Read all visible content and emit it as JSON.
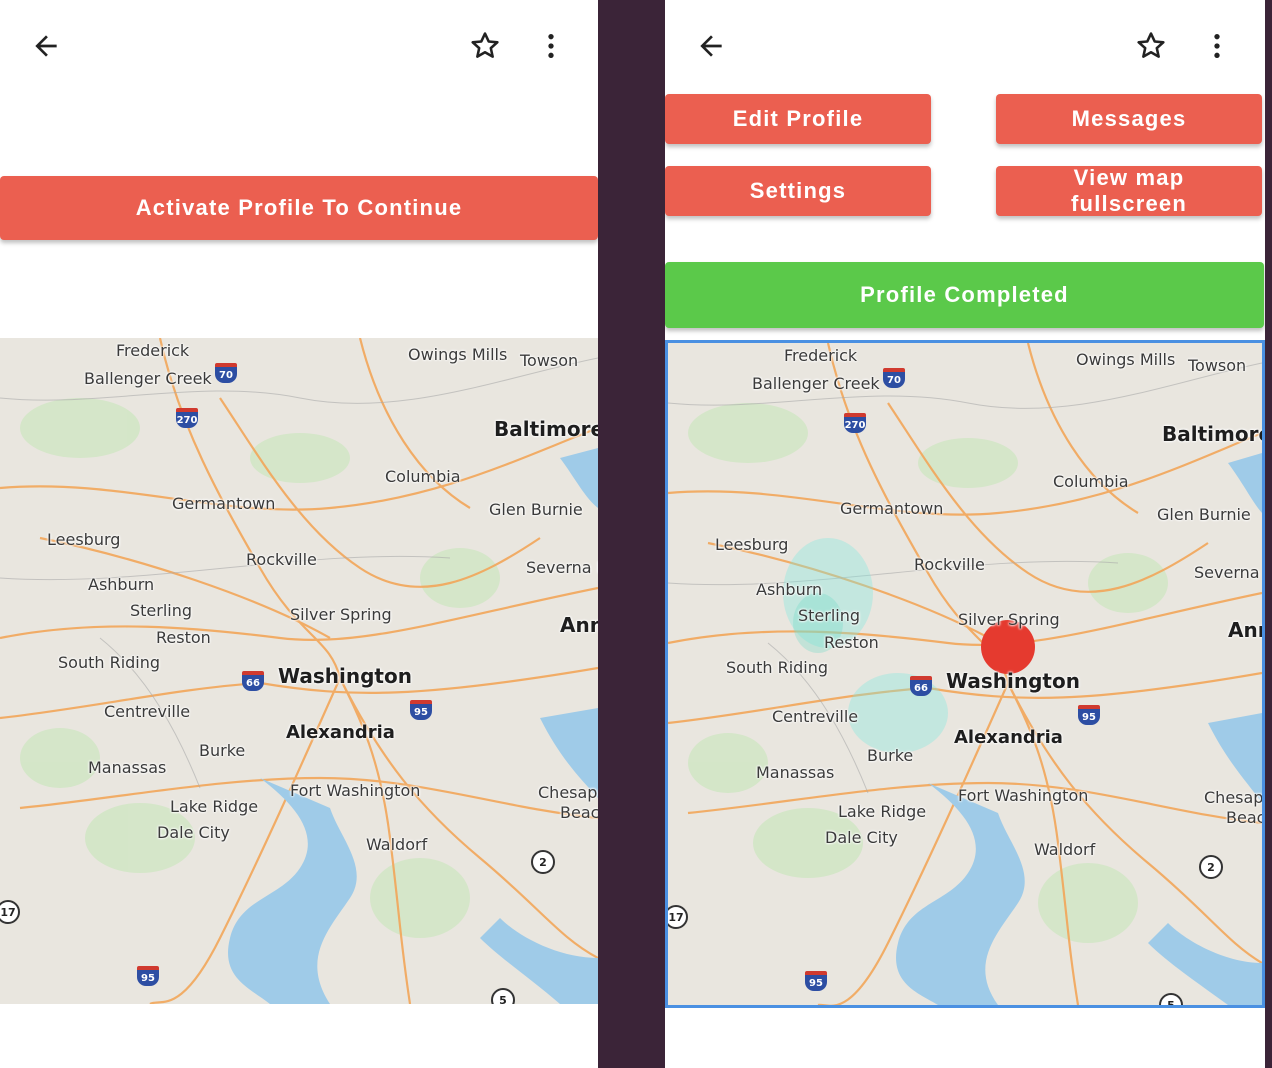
{
  "left_screen": {
    "activate_button_label": "Activate Profile To Continue"
  },
  "right_screen": {
    "edit_profile_label": "Edit Profile",
    "messages_label": "Messages",
    "settings_label": "Settings",
    "view_map_label": "View map fullscreen",
    "profile_completed_label": "Profile Completed"
  },
  "toolbar_icons": [
    "back-arrow-icon",
    "star-icon",
    "more-vert-icon"
  ],
  "colors": {
    "accent_red": "#eb5f50",
    "success_green": "#5bc94a",
    "map_selection_border": "#4a90e2",
    "marker_red": "#e53a2f",
    "divider": "#3b2438"
  },
  "map": {
    "places": [
      "Frederick",
      "Ballenger Creek",
      "Owings Mills",
      "Towson",
      "Baltimore",
      "Columbia",
      "Germantown",
      "Glen Burnie",
      "Leesburg",
      "Rockville",
      "Severna P",
      "Ashburn",
      "Sterling",
      "Silver Spring",
      "Reston",
      "Anna",
      "South Riding",
      "Washington",
      "Centreville",
      "Alexandria",
      "Burke",
      "Manassas",
      "Fort Washington",
      "Chesape",
      "Beac",
      "Lake Ridge",
      "Dale City",
      "Waldorf"
    ],
    "places_right_overrides": {
      "severna": "Severna P",
      "anna": "Ann"
    },
    "shields": [
      "70",
      "270",
      "66",
      "95",
      "95"
    ],
    "routes": [
      "2",
      "5",
      "17"
    ]
  }
}
